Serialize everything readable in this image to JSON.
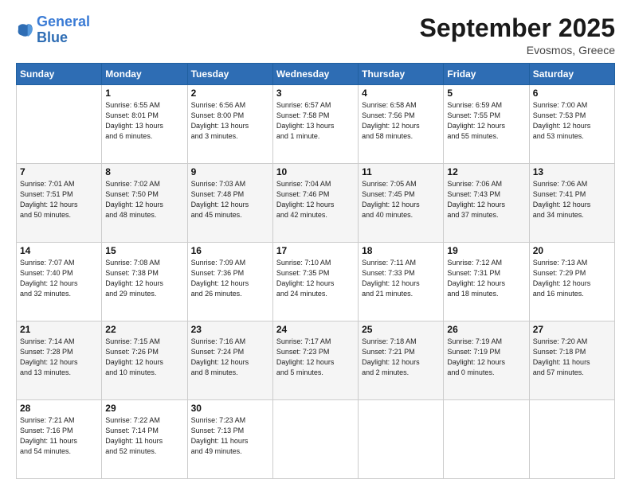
{
  "logo": {
    "text_general": "General",
    "text_blue": "Blue"
  },
  "header": {
    "title": "September 2025",
    "subtitle": "Evosmos, Greece"
  },
  "weekdays": [
    "Sunday",
    "Monday",
    "Tuesday",
    "Wednesday",
    "Thursday",
    "Friday",
    "Saturday"
  ],
  "weeks": [
    [
      {
        "num": "",
        "info": ""
      },
      {
        "num": "1",
        "info": "Sunrise: 6:55 AM\nSunset: 8:01 PM\nDaylight: 13 hours\nand 6 minutes."
      },
      {
        "num": "2",
        "info": "Sunrise: 6:56 AM\nSunset: 8:00 PM\nDaylight: 13 hours\nand 3 minutes."
      },
      {
        "num": "3",
        "info": "Sunrise: 6:57 AM\nSunset: 7:58 PM\nDaylight: 13 hours\nand 1 minute."
      },
      {
        "num": "4",
        "info": "Sunrise: 6:58 AM\nSunset: 7:56 PM\nDaylight: 12 hours\nand 58 minutes."
      },
      {
        "num": "5",
        "info": "Sunrise: 6:59 AM\nSunset: 7:55 PM\nDaylight: 12 hours\nand 55 minutes."
      },
      {
        "num": "6",
        "info": "Sunrise: 7:00 AM\nSunset: 7:53 PM\nDaylight: 12 hours\nand 53 minutes."
      }
    ],
    [
      {
        "num": "7",
        "info": "Sunrise: 7:01 AM\nSunset: 7:51 PM\nDaylight: 12 hours\nand 50 minutes."
      },
      {
        "num": "8",
        "info": "Sunrise: 7:02 AM\nSunset: 7:50 PM\nDaylight: 12 hours\nand 48 minutes."
      },
      {
        "num": "9",
        "info": "Sunrise: 7:03 AM\nSunset: 7:48 PM\nDaylight: 12 hours\nand 45 minutes."
      },
      {
        "num": "10",
        "info": "Sunrise: 7:04 AM\nSunset: 7:46 PM\nDaylight: 12 hours\nand 42 minutes."
      },
      {
        "num": "11",
        "info": "Sunrise: 7:05 AM\nSunset: 7:45 PM\nDaylight: 12 hours\nand 40 minutes."
      },
      {
        "num": "12",
        "info": "Sunrise: 7:06 AM\nSunset: 7:43 PM\nDaylight: 12 hours\nand 37 minutes."
      },
      {
        "num": "13",
        "info": "Sunrise: 7:06 AM\nSunset: 7:41 PM\nDaylight: 12 hours\nand 34 minutes."
      }
    ],
    [
      {
        "num": "14",
        "info": "Sunrise: 7:07 AM\nSunset: 7:40 PM\nDaylight: 12 hours\nand 32 minutes."
      },
      {
        "num": "15",
        "info": "Sunrise: 7:08 AM\nSunset: 7:38 PM\nDaylight: 12 hours\nand 29 minutes."
      },
      {
        "num": "16",
        "info": "Sunrise: 7:09 AM\nSunset: 7:36 PM\nDaylight: 12 hours\nand 26 minutes."
      },
      {
        "num": "17",
        "info": "Sunrise: 7:10 AM\nSunset: 7:35 PM\nDaylight: 12 hours\nand 24 minutes."
      },
      {
        "num": "18",
        "info": "Sunrise: 7:11 AM\nSunset: 7:33 PM\nDaylight: 12 hours\nand 21 minutes."
      },
      {
        "num": "19",
        "info": "Sunrise: 7:12 AM\nSunset: 7:31 PM\nDaylight: 12 hours\nand 18 minutes."
      },
      {
        "num": "20",
        "info": "Sunrise: 7:13 AM\nSunset: 7:29 PM\nDaylight: 12 hours\nand 16 minutes."
      }
    ],
    [
      {
        "num": "21",
        "info": "Sunrise: 7:14 AM\nSunset: 7:28 PM\nDaylight: 12 hours\nand 13 minutes."
      },
      {
        "num": "22",
        "info": "Sunrise: 7:15 AM\nSunset: 7:26 PM\nDaylight: 12 hours\nand 10 minutes."
      },
      {
        "num": "23",
        "info": "Sunrise: 7:16 AM\nSunset: 7:24 PM\nDaylight: 12 hours\nand 8 minutes."
      },
      {
        "num": "24",
        "info": "Sunrise: 7:17 AM\nSunset: 7:23 PM\nDaylight: 12 hours\nand 5 minutes."
      },
      {
        "num": "25",
        "info": "Sunrise: 7:18 AM\nSunset: 7:21 PM\nDaylight: 12 hours\nand 2 minutes."
      },
      {
        "num": "26",
        "info": "Sunrise: 7:19 AM\nSunset: 7:19 PM\nDaylight: 12 hours\nand 0 minutes."
      },
      {
        "num": "27",
        "info": "Sunrise: 7:20 AM\nSunset: 7:18 PM\nDaylight: 11 hours\nand 57 minutes."
      }
    ],
    [
      {
        "num": "28",
        "info": "Sunrise: 7:21 AM\nSunset: 7:16 PM\nDaylight: 11 hours\nand 54 minutes."
      },
      {
        "num": "29",
        "info": "Sunrise: 7:22 AM\nSunset: 7:14 PM\nDaylight: 11 hours\nand 52 minutes."
      },
      {
        "num": "30",
        "info": "Sunrise: 7:23 AM\nSunset: 7:13 PM\nDaylight: 11 hours\nand 49 minutes."
      },
      {
        "num": "",
        "info": ""
      },
      {
        "num": "",
        "info": ""
      },
      {
        "num": "",
        "info": ""
      },
      {
        "num": "",
        "info": ""
      }
    ]
  ]
}
